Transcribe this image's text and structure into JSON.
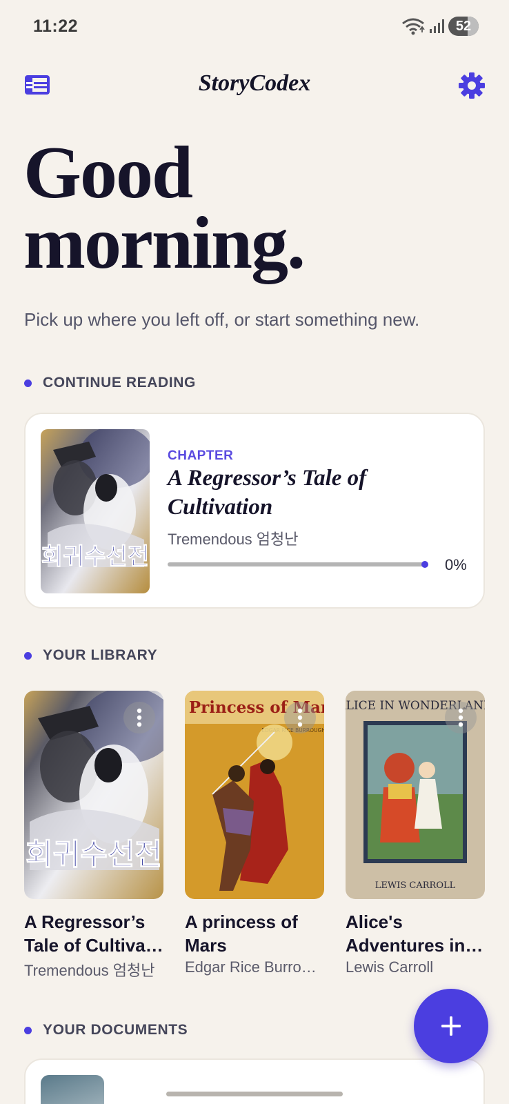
{
  "status_bar": {
    "time": "11:22",
    "battery": "52"
  },
  "app_bar": {
    "title": "StoryCodex"
  },
  "greeting": {
    "line1": "Good",
    "line2": "morning.",
    "subtitle": "Pick up where you left off, or start something new."
  },
  "sections": {
    "continue_reading": "CONTINUE READING",
    "your_library": "YOUR LIBRARY",
    "your_documents": "YOUR DOCUMENTS"
  },
  "continue_reading": {
    "label": "CHAPTER",
    "title_line1": "A Regressor’s Tale of",
    "title_line2": "Cultivation",
    "author": "Tremendous 엄청난",
    "progress_percent": 0,
    "progress_text": "0%"
  },
  "library": [
    {
      "title_line1": "A Regressor’s",
      "title_line2": "Tale of Cultivation",
      "author": "Tremendous 엄청난",
      "cover_text": "회귀수선전"
    },
    {
      "title_line1": "A princess of",
      "title_line2": "Mars",
      "author": "Edgar Rice Burroughs",
      "cover_text": "A Princess of Mars",
      "cover_subtext": "EDGAR RICE BURROUGHS"
    },
    {
      "title_line1": "Alice's",
      "title_line2": "Adventures in Wonderland",
      "author": "Lewis Carroll",
      "cover_text": "ALICE IN WONDERLAND",
      "cover_subtext": "LEWIS CARROLL"
    }
  ],
  "icons": {
    "menu": "list-icon",
    "settings": "gear-icon",
    "more": "more-vert-icon",
    "fab": "plus-icon"
  },
  "colors": {
    "accent": "#4b3ee0",
    "background": "#f6f2ec"
  }
}
